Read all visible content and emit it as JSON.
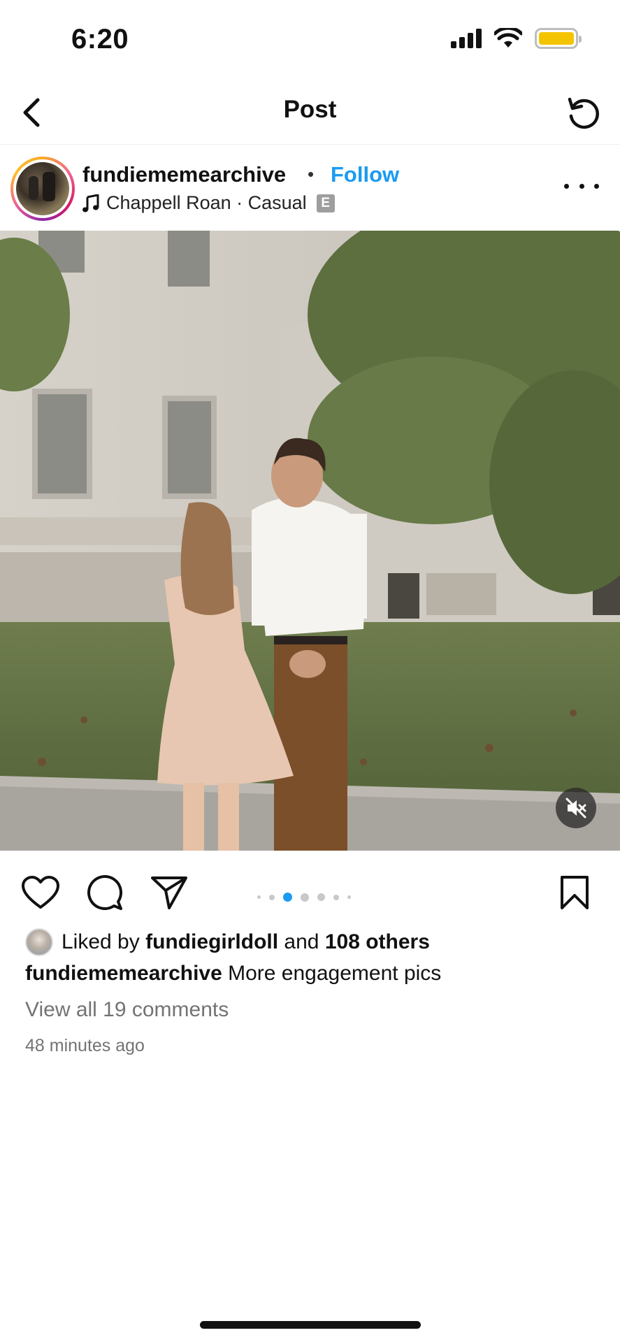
{
  "status_bar": {
    "time": "6:20",
    "icons": [
      "cellular-signal-icon",
      "wifi-icon",
      "battery-icon"
    ],
    "battery_color": "#f5c400"
  },
  "nav": {
    "title": "Post",
    "back_icon": "chevron-left-icon",
    "refresh_icon": "refresh-icon"
  },
  "post": {
    "username": "fundiememearchive",
    "separator": "•",
    "follow_label": "Follow",
    "follow_color": "#1a9bf0",
    "music": {
      "icon": "music-note-icon",
      "text": "Chappell Roan · Casual",
      "explicit_badge": "E"
    },
    "media": {
      "mute_icon": "muted-speaker-icon"
    },
    "carousel": {
      "total": 7,
      "active_index": 2,
      "active_color": "#1a9bf0"
    },
    "actions": [
      "heart-icon",
      "comment-icon",
      "share-icon",
      "bookmark-icon"
    ],
    "likes": {
      "prefix": "Liked by",
      "user": "fundiegirldoll",
      "conjunction": "and",
      "others": "108 others"
    },
    "caption": {
      "user": "fundiememearchive",
      "text": "More engagement pics"
    },
    "view_comments": "View all 19 comments",
    "time_ago": "48 minutes ago"
  }
}
